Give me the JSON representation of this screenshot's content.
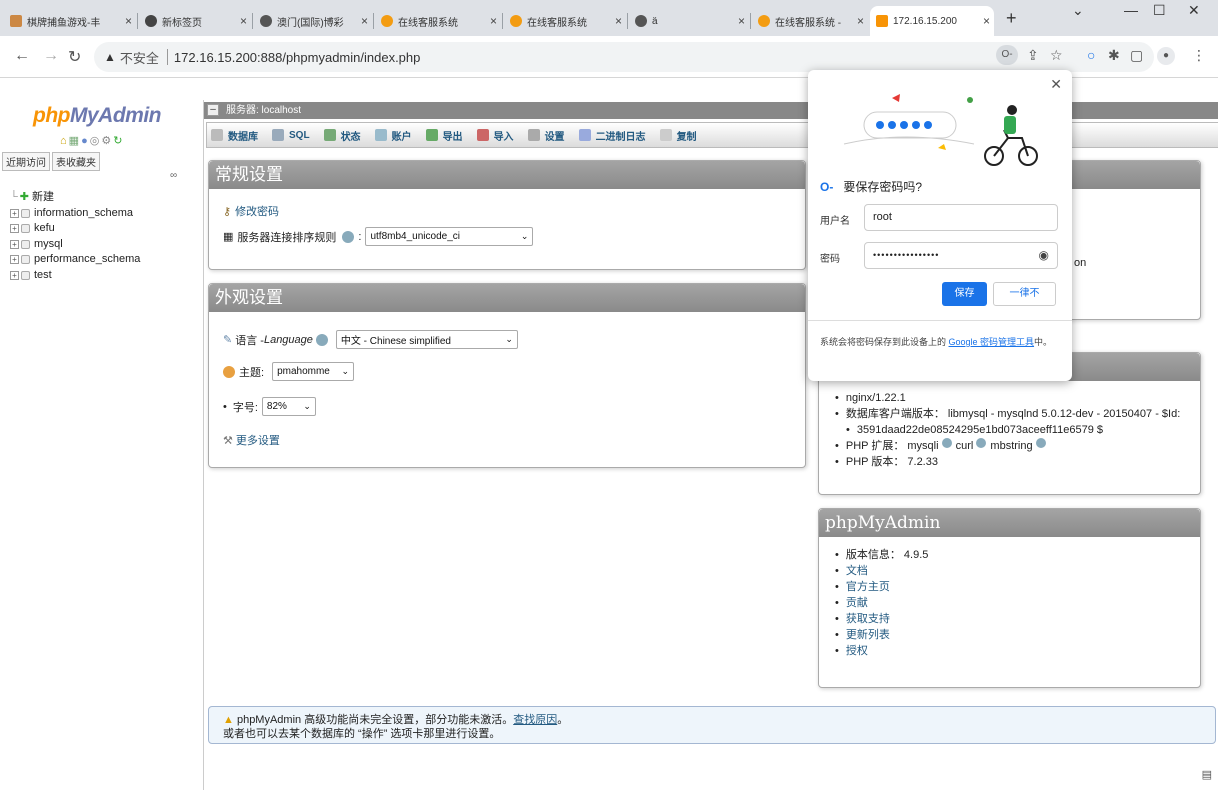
{
  "browser": {
    "tabs": [
      {
        "label": "棋牌捕鱼游戏-丰"
      },
      {
        "label": "新标签页"
      },
      {
        "label": "澳门(国际)博彩"
      },
      {
        "label": "在线客服系统"
      },
      {
        "label": "在线客服系统"
      },
      {
        "label": "ä"
      },
      {
        "label": "在线客服系统 -"
      },
      {
        "label": "172.16.15.200"
      }
    ],
    "new_tab": "+",
    "insecure_label": "不安全",
    "url": "172.16.15.200:888/phpmyadmin/index.php"
  },
  "sidebar": {
    "logo_php": "php",
    "logo_myadmin": "MyAdmin",
    "tab_recent": "近期访问",
    "tab_favorites": "表收藏夹",
    "new_label": "新建",
    "databases": [
      "information_schema",
      "kefu",
      "mysql",
      "performance_schema",
      "test"
    ]
  },
  "server_bar": {
    "label": "服务器: localhost"
  },
  "menu": [
    "数据库",
    "SQL",
    "状态",
    "账户",
    "导出",
    "导入",
    "设置",
    "二进制日志",
    "复制"
  ],
  "general_settings": {
    "title": "常规设置",
    "change_password": "修改密码",
    "collation_label": "服务器连接排序规则",
    "collation_value": "utf8mb4_unicode_ci"
  },
  "appearance_settings": {
    "title": "外观设置",
    "language_label": "语言 - ",
    "language_italic": "Language",
    "language_value": "中文 - Chinese simplified",
    "theme_label": "主题:",
    "theme_value": "pmahomme",
    "fontsize_label": "字号:",
    "fontsize_value": "82%",
    "more_settings": "更多设置"
  },
  "web_server": {
    "items": [
      "nginx/1.22.1",
      "数据库客户端版本： libmysql - mysqlnd 5.0.12-dev - 20150407 - $Id:",
      "3591daad22de08524295e1bd073aceeff11e6579 $",
      "PHP 扩展： mysqli",
      "curl",
      "mbstring",
      "PHP 版本： 7.2.33"
    ],
    "partial_text": "on"
  },
  "phpmyadmin_panel": {
    "title": "phpMyAdmin",
    "items": [
      "版本信息： 4.9.5",
      "文档",
      "官方主页",
      "贡献",
      "获取支持",
      "更新列表",
      "授权"
    ]
  },
  "notice": {
    "line1": "phpMyAdmin 高级功能尚未完全设置，部分功能未激活。",
    "link": "查找原因",
    "line1_end": "。",
    "line2": "或者也可以去某个数据库的 “操作” 选项卡那里进行设置。"
  },
  "password_popup": {
    "title": "要保存密码吗?",
    "username_label": "用户名",
    "username_value": "root",
    "password_label": "密码",
    "password_value": "••••••••••••••••",
    "save_label": "保存",
    "never_label": "一律不",
    "footer_text": "系统会将密码保存到此设备上的 ",
    "footer_link": "Google 密码管理工具",
    "footer_end": "中。"
  },
  "colors": {
    "accent": "#1a73e8",
    "pma_link": "#235a81",
    "panel_header": "#999999"
  }
}
